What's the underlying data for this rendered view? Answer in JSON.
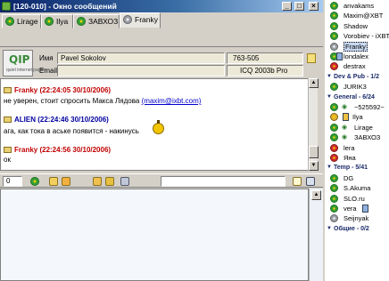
{
  "window": {
    "title": "[120-010] - Окно сообщений",
    "buttons": {
      "minimize": "_",
      "maximize": "□",
      "close": "×"
    }
  },
  "tabs": [
    {
      "label": "Lirage"
    },
    {
      "label": "Ilya"
    },
    {
      "label": "ЗАВХОЗ"
    },
    {
      "label": "Franky"
    }
  ],
  "contact_info": {
    "name_label": "Имя",
    "name_value": "Pavel Sokolov",
    "uin_value": "763-505",
    "email_label": "Email",
    "email_value": "",
    "client_value": "ICQ 2003b Pro",
    "logo_text": "QIP",
    "logo_sub": "quiet internet pager"
  },
  "history": [
    {
      "header": "Franky (22:24:05 30/10/2006)",
      "text": "не уверен, стоит спросить Макса Лядова",
      "link": "(maxim@ixbt.com)",
      "color": "#c00000"
    },
    {
      "header": "ALIEN (22:24:46 30/10/2006)",
      "text": "ага, как тока в аське появится - накинусь",
      "link": "",
      "color": "#0000a0"
    },
    {
      "header": "Franky (22:24:56 30/10/2006)",
      "text": "ок",
      "link": "",
      "color": "#c00000"
    }
  ],
  "toolbar": {
    "counter": "0"
  },
  "contact_list": {
    "items": [
      {
        "kind": "contact",
        "label": "anvakams",
        "icon": "flower"
      },
      {
        "kind": "contact",
        "label": "Maxim@XBT",
        "icon": "flower"
      },
      {
        "kind": "contact",
        "label": "Shadow",
        "icon": "flower"
      },
      {
        "kind": "contact",
        "label": "Vorobiev - iXBT",
        "icon": "flower"
      },
      {
        "kind": "contact",
        "label": "Franky",
        "icon": "flower-gray",
        "selected": true
      },
      {
        "kind": "contact",
        "label": "londalex",
        "icon": "flower",
        "extra": true
      },
      {
        "kind": "contact",
        "label": "destrax",
        "icon": "flower-red"
      },
      {
        "kind": "group",
        "label": "Dev & Pub - 1/2"
      },
      {
        "kind": "contact",
        "label": "JURIK3",
        "icon": "flower"
      },
      {
        "kind": "group",
        "label": "General - 6/24"
      },
      {
        "kind": "contact",
        "label": "~525592~",
        "icon": "flower",
        "eye": true
      },
      {
        "kind": "contact",
        "label": "Ilya",
        "icon": "flower-away",
        "extra_left": true
      },
      {
        "kind": "contact",
        "label": "Lirage",
        "icon": "flower",
        "eye": true
      },
      {
        "kind": "contact",
        "label": "ЗАВХОЗ",
        "icon": "flower",
        "eye": true
      },
      {
        "kind": "contact",
        "label": "lera",
        "icon": "flower-red"
      },
      {
        "kind": "contact",
        "label": "Яна",
        "icon": "flower-red"
      },
      {
        "kind": "group",
        "label": "Temp - 5/41"
      },
      {
        "kind": "contact",
        "label": "DG",
        "icon": "flower"
      },
      {
        "kind": "contact",
        "label": "S.Akuma",
        "icon": "flower"
      },
      {
        "kind": "contact",
        "label": "SLO.ru",
        "icon": "flower"
      },
      {
        "kind": "contact",
        "label": "vera",
        "icon": "flower",
        "extra": true
      },
      {
        "kind": "contact",
        "label": "Seijnyak",
        "icon": "flower-gray"
      },
      {
        "kind": "group",
        "label": "Общие - 0/2"
      }
    ]
  }
}
